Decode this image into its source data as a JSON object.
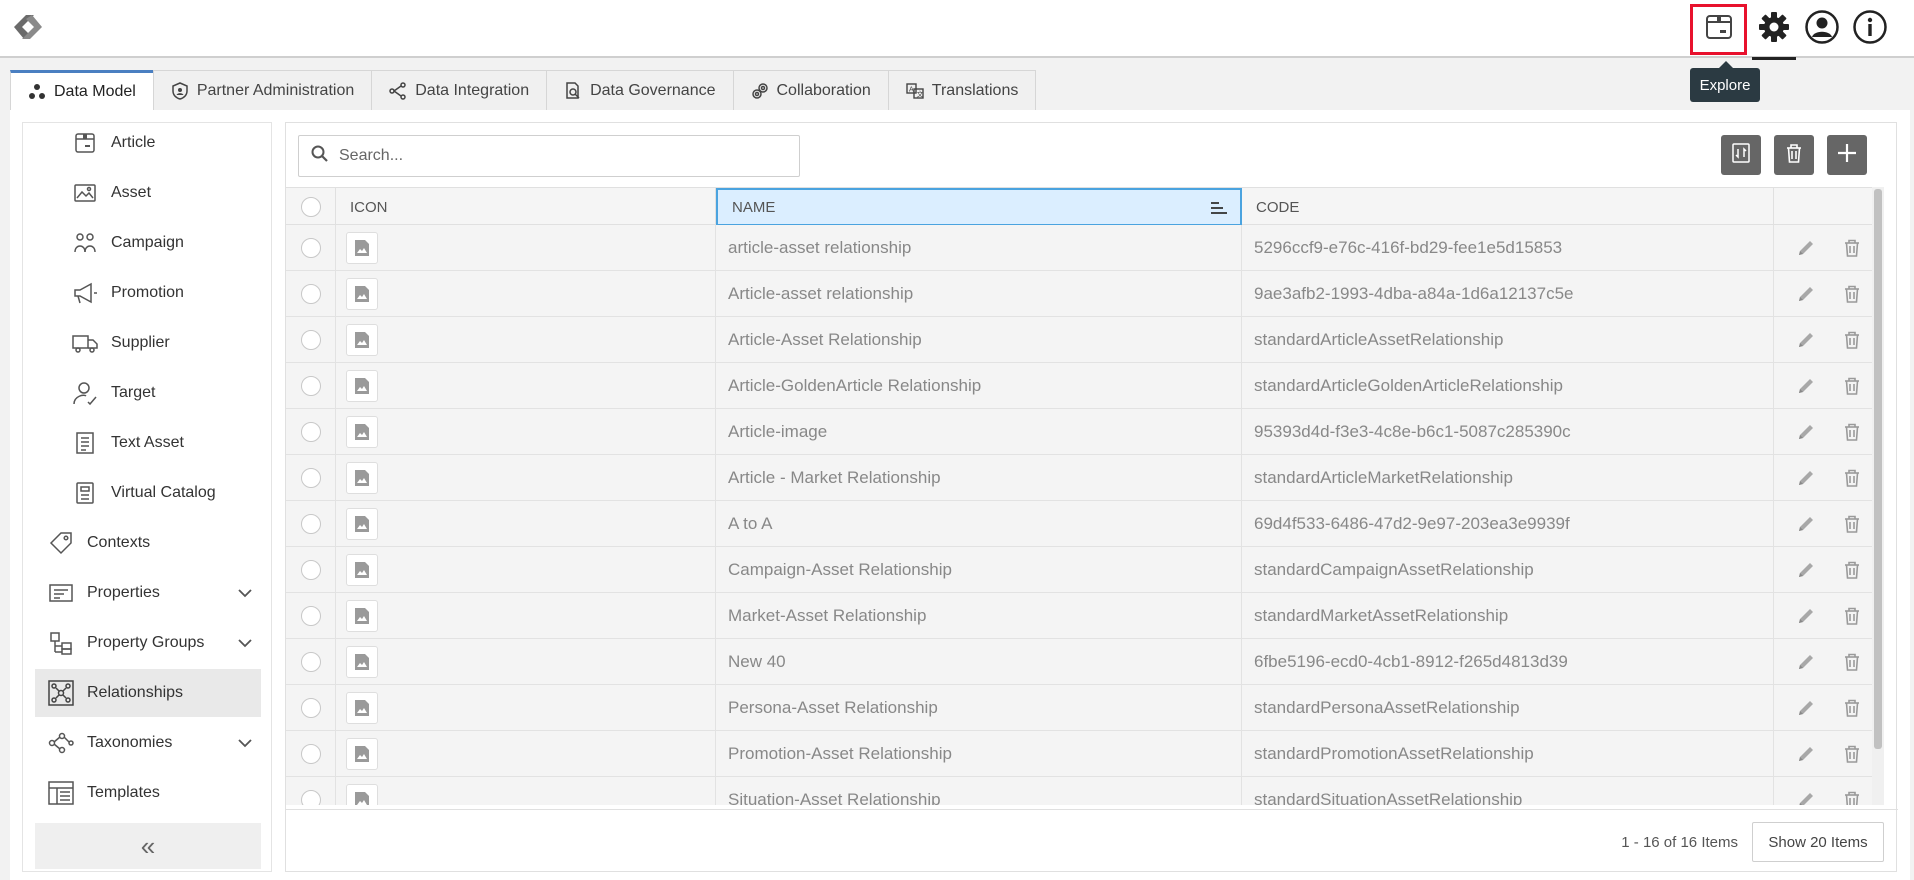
{
  "header": {
    "tooltip": "Explore",
    "icons": [
      "logo-icon",
      "explore-icon",
      "gear-icon",
      "user-icon",
      "info-icon"
    ]
  },
  "tabs": [
    {
      "label": "Data Model",
      "icon": "data-model-icon",
      "active": true
    },
    {
      "label": "Partner Administration",
      "icon": "shield-icon",
      "active": false
    },
    {
      "label": "Data Integration",
      "icon": "integration-icon",
      "active": false
    },
    {
      "label": "Data Governance",
      "icon": "governance-icon",
      "active": false
    },
    {
      "label": "Collaboration",
      "icon": "collaboration-icon",
      "active": false
    },
    {
      "label": "Translations",
      "icon": "translations-icon",
      "active": false
    }
  ],
  "sidebar": {
    "items": [
      {
        "label": "Article",
        "icon": "article-icon",
        "level": "sub"
      },
      {
        "label": "Asset",
        "icon": "asset-icon",
        "level": "sub"
      },
      {
        "label": "Campaign",
        "icon": "campaign-icon",
        "level": "sub"
      },
      {
        "label": "Promotion",
        "icon": "megaphone-icon",
        "level": "sub"
      },
      {
        "label": "Supplier",
        "icon": "truck-icon",
        "level": "sub"
      },
      {
        "label": "Target",
        "icon": "target-user-icon",
        "level": "sub"
      },
      {
        "label": "Text Asset",
        "icon": "text-document-icon",
        "level": "sub"
      },
      {
        "label": "Virtual Catalog",
        "icon": "catalog-icon",
        "level": "sub"
      },
      {
        "label": "Contexts",
        "icon": "tag-icon",
        "level": "top"
      },
      {
        "label": "Properties",
        "icon": "properties-icon",
        "level": "top",
        "expandable": true
      },
      {
        "label": "Property Groups",
        "icon": "property-groups-icon",
        "level": "top",
        "expandable": true
      },
      {
        "label": "Relationships",
        "icon": "relationships-icon",
        "level": "top",
        "active": true
      },
      {
        "label": "Taxonomies",
        "icon": "taxonomies-icon",
        "level": "top",
        "expandable": true
      },
      {
        "label": "Templates",
        "icon": "templates-icon",
        "level": "top"
      }
    ],
    "collapse_label": "«"
  },
  "toolbar": {
    "search_placeholder": "Search..."
  },
  "grid": {
    "columns": {
      "icon": "ICON",
      "name": "NAME",
      "code": "CODE"
    },
    "rows": [
      {
        "name": "article-asset relationship",
        "code": "5296ccf9-e76c-416f-bd29-fee1e5d15853"
      },
      {
        "name": "Article-asset relationship",
        "code": "9ae3afb2-1993-4dba-a84a-1d6a12137c5e"
      },
      {
        "name": "Article-Asset Relationship",
        "code": "standardArticleAssetRelationship"
      },
      {
        "name": "Article-GoldenArticle Relationship",
        "code": "standardArticleGoldenArticleRelationship"
      },
      {
        "name": "Article-image",
        "code": "95393d4d-f3e3-4c8e-b6c1-5087c285390c"
      },
      {
        "name": "Article - Market Relationship",
        "code": "standardArticleMarketRelationship"
      },
      {
        "name": "A to A",
        "code": "69d4f533-6486-47d2-9e97-203ea3e9939f"
      },
      {
        "name": "Campaign-Asset Relationship",
        "code": "standardCampaignAssetRelationship"
      },
      {
        "name": "Market-Asset Relationship",
        "code": "standardMarketAssetRelationship"
      },
      {
        "name": "New 40",
        "code": "6fbe5196-ecd0-4cb1-8912-f265d4813d39"
      },
      {
        "name": "Persona-Asset Relationship",
        "code": "standardPersonaAssetRelationship"
      },
      {
        "name": "Promotion-Asset Relationship",
        "code": "standardPromotionAssetRelationship"
      },
      {
        "name": "Situation-Asset Relationship",
        "code": "standardSituationAssetRelationship"
      }
    ]
  },
  "footer": {
    "pager_text": "1 - 16 of 16 Items",
    "page_size": "Show 20 Items"
  }
}
